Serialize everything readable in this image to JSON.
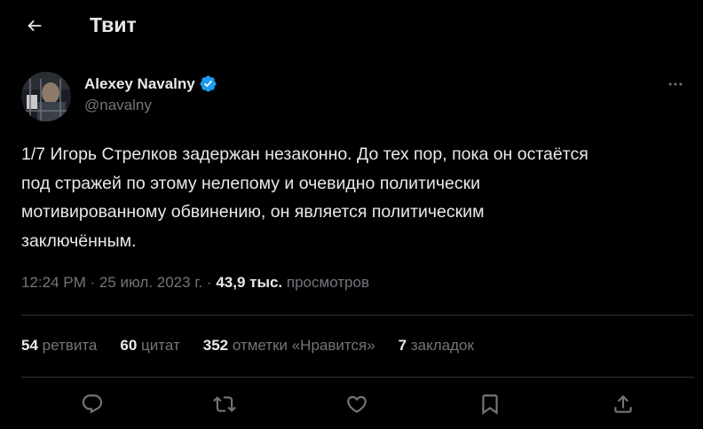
{
  "header": {
    "title": "Твит",
    "back_icon": "arrow-left-icon"
  },
  "author": {
    "display_name": "Alexey Navalny",
    "handle": "@navalny",
    "verified": true,
    "verified_color": "#1d9bf0",
    "more_icon": "more-horizontal-icon"
  },
  "tweet": {
    "text": "1/7 Игорь Стрелков задержан незаконно. До тех пор, пока он остаётся\nпод стражей по этому нелепому и очевидно политически\nмотивированному обвинению, он является политическим\nзаключённым."
  },
  "meta": {
    "time": "12:24 PM",
    "separator": "·",
    "date": "25 июл. 2023 г.",
    "views_count": "43,9 тыс.",
    "views_label": "просмотров"
  },
  "stats": [
    {
      "count": "54",
      "label": "ретвита"
    },
    {
      "count": "60",
      "label": "цитат"
    },
    {
      "count": "352",
      "label": "отметки «Нравится»"
    },
    {
      "count": "7",
      "label": "закладок"
    }
  ],
  "actions": [
    {
      "name": "reply",
      "icon": "reply-bubble-icon"
    },
    {
      "name": "retweet",
      "icon": "retweet-icon"
    },
    {
      "name": "like",
      "icon": "heart-icon"
    },
    {
      "name": "bookmark",
      "icon": "bookmark-icon"
    },
    {
      "name": "share",
      "icon": "share-icon"
    }
  ],
  "colors": {
    "background": "#000000",
    "text_primary": "#e7e9ea",
    "text_secondary": "#71767b",
    "divider": "#2f3336",
    "accent": "#1d9bf0"
  }
}
